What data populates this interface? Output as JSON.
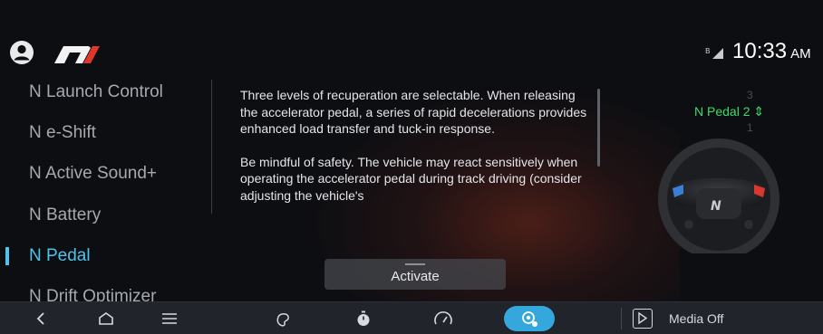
{
  "status_bar": {
    "time": "10:33",
    "ampm": "AM"
  },
  "sidebar": {
    "items": [
      {
        "label": "N Launch Control"
      },
      {
        "label": "N e-Shift"
      },
      {
        "label": "N Active Sound+"
      },
      {
        "label": "N Battery"
      },
      {
        "label": "N Pedal",
        "active": true
      },
      {
        "label": "N Drift Optimizer"
      }
    ]
  },
  "content": {
    "paragraph_1": "Three levels of recuperation are selectable. When releasing the accelerator pedal, a series of rapid decelerations provides enhanced load transfer and tuck-in response.",
    "paragraph_2": "Be mindful of safety. The vehicle may react sensitively when operating the accelerator pedal during track driving (consider adjusting the vehicle's",
    "activate_label": "Activate"
  },
  "pedal": {
    "level_above": "3",
    "current": "N Pedal 2",
    "level_below": "1"
  },
  "navbar": {
    "media_label": "Media Off"
  },
  "colors": {
    "accent": "#4fc3ea",
    "level_green": "#3ddc69",
    "nav_active": "#34a8dc",
    "background": "#0c0e12"
  }
}
